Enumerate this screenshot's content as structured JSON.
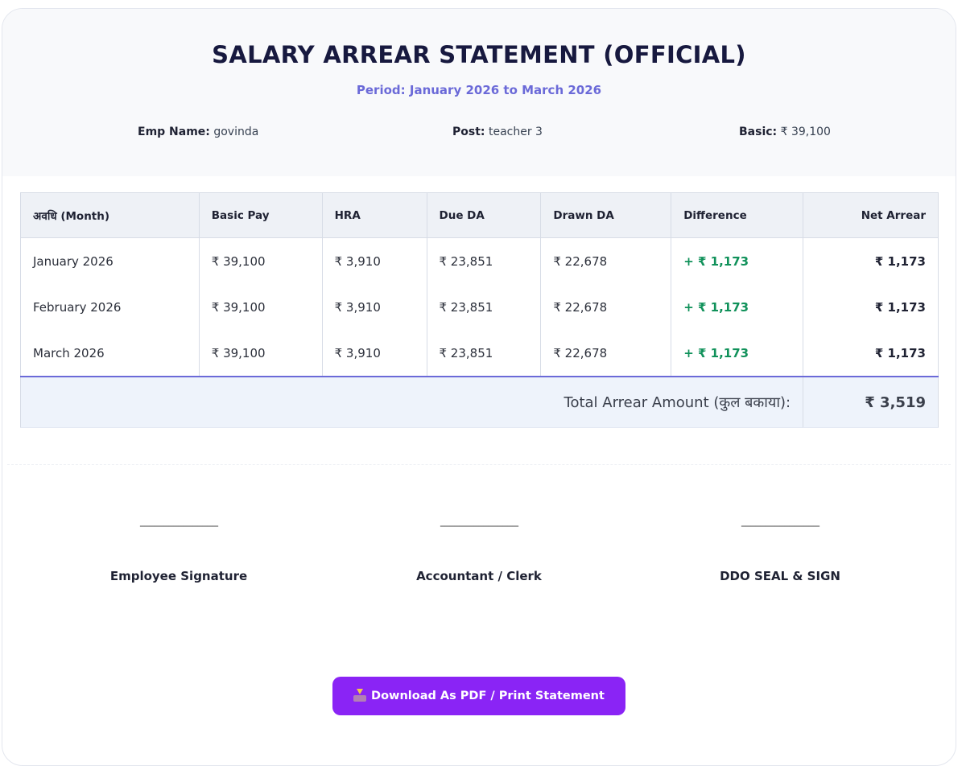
{
  "header": {
    "title": "SALARY ARREAR STATEMENT (OFFICIAL)",
    "period": "Period: January 2026 to March 2026",
    "emp_name_label": "Emp Name:",
    "emp_name_value": "govinda",
    "post_label": "Post:",
    "post_value": "teacher 3",
    "basic_label": "Basic:",
    "basic_value": "₹ 39,100"
  },
  "table": {
    "columns": [
      "अवधि (Month)",
      "Basic Pay",
      "HRA",
      "Due DA",
      "Drawn DA",
      "Difference",
      "Net Arrear"
    ],
    "rows": [
      {
        "month": "January 2026",
        "basic": "₹ 39,100",
        "hra": "₹ 3,910",
        "due_da": "₹ 23,851",
        "drawn_da": "₹ 22,678",
        "difference": "+ ₹ 1,173",
        "net": "₹ 1,173"
      },
      {
        "month": "February 2026",
        "basic": "₹ 39,100",
        "hra": "₹ 3,910",
        "due_da": "₹ 23,851",
        "drawn_da": "₹ 22,678",
        "difference": "+ ₹ 1,173",
        "net": "₹ 1,173"
      },
      {
        "month": "March 2026",
        "basic": "₹ 39,100",
        "hra": "₹ 3,910",
        "due_da": "₹ 23,851",
        "drawn_da": "₹ 22,678",
        "difference": "+ ₹ 1,173",
        "net": "₹ 1,173"
      }
    ],
    "total_label": "Total Arrear Amount (कुल बकाया):",
    "total_value": "₹ 3,519"
  },
  "signatures": {
    "line": "________________",
    "employee": "Employee Signature",
    "accountant": "Accountant / Clerk",
    "ddo": "DDO SEAL & SIGN"
  },
  "actions": {
    "download_label": "Download As PDF / Print Statement",
    "download_icon": "inbox-tray-icon"
  },
  "colors": {
    "title": "#17193f",
    "period": "#6b6ad8",
    "positive": "#10915a",
    "button": "#8a24f5"
  }
}
